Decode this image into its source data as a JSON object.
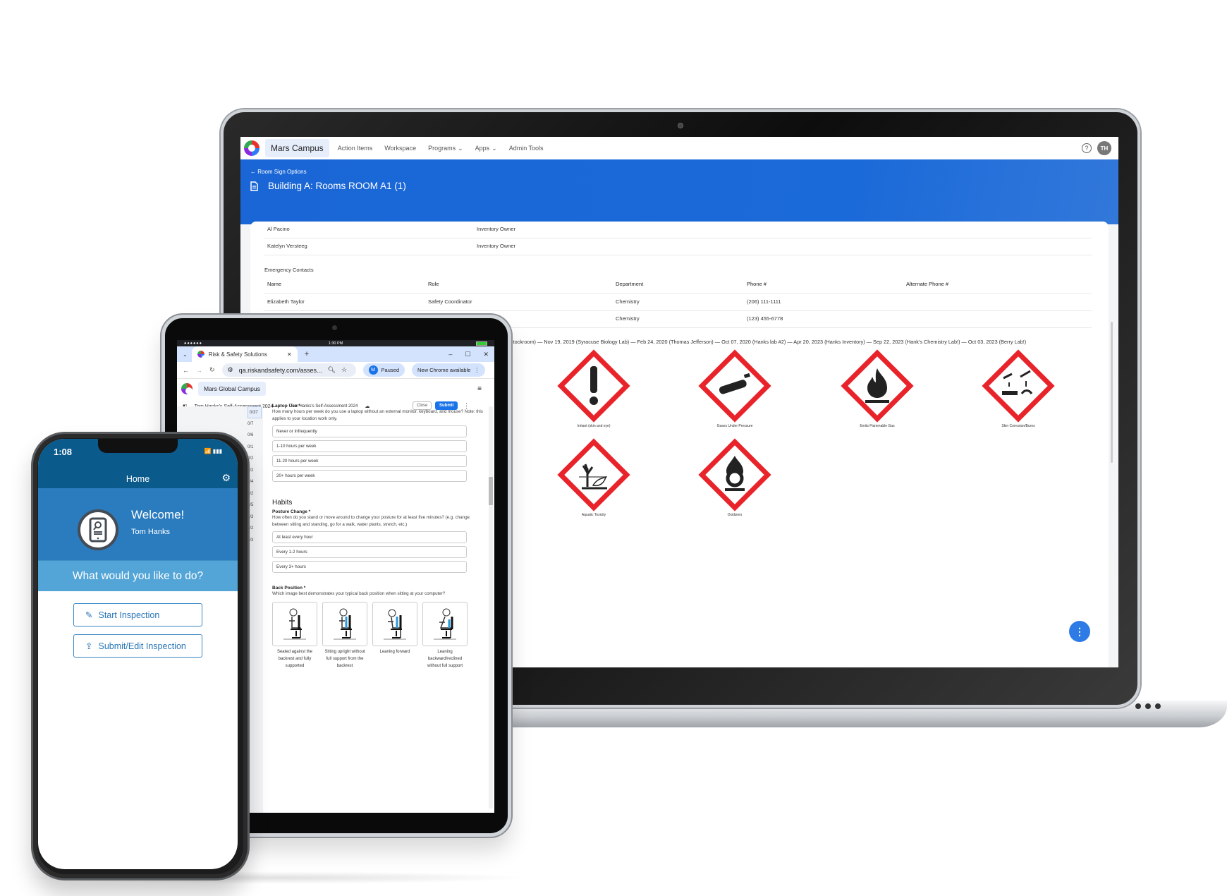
{
  "laptop": {
    "nav": {
      "campus": "Mars Campus",
      "items": [
        {
          "label": "Action Items",
          "dropdown": false
        },
        {
          "label": "Workspace",
          "dropdown": false
        },
        {
          "label": "Programs",
          "dropdown": true
        },
        {
          "label": "Apps",
          "dropdown": true
        },
        {
          "label": "Admin Tools",
          "dropdown": false
        }
      ],
      "help_icon": "?",
      "avatar_initials": "TH"
    },
    "hero": {
      "back_label": "Room Sign Options",
      "title": "Building A: Rooms ROOM A1 (1)"
    },
    "owners": [
      {
        "name": "Al Pacino",
        "role": "Inventory Owner"
      },
      {
        "name": "Katelyn Versteeg",
        "role": "Inventory Owner"
      }
    ],
    "emergency": {
      "section_label": "Emergency Contacts",
      "columns": [
        "Name",
        "Role",
        "Department",
        "Phone #",
        "Alternate Phone #"
      ],
      "rows": [
        {
          "name": "Elizabeth Taylor",
          "role": "Safety Coordinator",
          "department": "Chemistry",
          "phone": "(206) 111-1111",
          "alt": ""
        },
        {
          "name": "",
          "role": "",
          "department": "Chemistry",
          "phone": "(123) 455-6778",
          "alt": ""
        }
      ]
    },
    "timeline": "y Stockroom) — Nov 19, 2019 (Syracuse Biology Lab) — Feb 24, 2020 (Thomas Jefferson) — Oct 07, 2020 (Hanks lab #2) — Apr 20, 2023 (Hanks Inventory) — Sep 22, 2023 (Hank's Chemistry Lab!) — Oct 03, 2023 (Berry Lab!)",
    "hazards": [
      {
        "label": "Irritant (skin and eye)",
        "icon": "exclamation"
      },
      {
        "label": "Gases Under Pressure",
        "icon": "gas-cylinder"
      },
      {
        "label": "Emits Flammable Gas",
        "icon": "flame"
      },
      {
        "label": "Skin Corrosion/Burns",
        "icon": "corrosion"
      },
      {
        "label": "Aquatic Toxicity",
        "icon": "environment"
      },
      {
        "label": "Oxidizers",
        "icon": "flame-over-circle"
      }
    ],
    "fab_icon": "⋮",
    "colors": {
      "hero": "#1a66d6",
      "ghs_red": "#e8242a",
      "fab": "#2f7be6"
    }
  },
  "tablet": {
    "status": {
      "signal": "●●●●●●",
      "time": "1:30 PM"
    },
    "browser": {
      "tab_title": "Risk & Safety Solutions",
      "new_tab": "+",
      "url": "qa.riskandsafety.com/asses...",
      "profile_initial": "M",
      "profile_status": "Paused",
      "update_label": "New Chrome available"
    },
    "app": {
      "campus": "Mars Global Campus",
      "breadcrumb": "Tom Hanks's Self-Assessment 2024",
      "doc_title": "Tom Hanks's Self-Assessment 2024",
      "close_label": "Close",
      "submit_label": "Submit"
    },
    "counts": [
      "0/37",
      "0/7",
      "0/6",
      "0/1",
      "0/2",
      "0/2",
      "0/4",
      "0/2",
      "0/5",
      "0/3",
      "0/2",
      "0/3"
    ],
    "form": {
      "q1": {
        "title": "Laptop Use *",
        "desc": "How many hours per week do you use a laptop without an external monitor, keyboard, and mouse? Note: this applies to your location work only.",
        "options": [
          "Never or Infrequently",
          "1-10 hours per week",
          "11-20 hours per week",
          "20+ hours per week"
        ]
      },
      "section": "Habits",
      "q2": {
        "title": "Posture Change *",
        "desc": "How often do you stand or move around to change your posture for at least five minutes? (e.g. change between sitting and standing, go for a walk, water plants, stretch, etc.)",
        "options": [
          "At least every hour",
          "Every 1-2 hours",
          "Every 3+ hours"
        ]
      },
      "q3": {
        "title": "Back Position *",
        "desc": "Which image best demonstrates your typical back position when sitting at your computer?",
        "figures": [
          "Seated against the backrest and fully supported",
          "Sitting upright without full support from the backrest",
          "Leaning forward",
          "Leaning backward/reclined without full support"
        ]
      }
    }
  },
  "phone": {
    "time": "1:08",
    "status_icons": "📶 ▮▮▮",
    "header_title": "Home",
    "welcome_title": "Welcome!",
    "user_name": "Tom Hanks",
    "prompt": "What would you like to do?",
    "buttons": [
      {
        "label": "Start Inspection",
        "icon": "edit-square"
      },
      {
        "label": "Submit/Edit Inspection",
        "icon": "share-box"
      }
    ],
    "colors": {
      "header": "#0b5a8c",
      "welcome": "#2b7cbf",
      "prompt_bar": "#53a5d7"
    }
  }
}
